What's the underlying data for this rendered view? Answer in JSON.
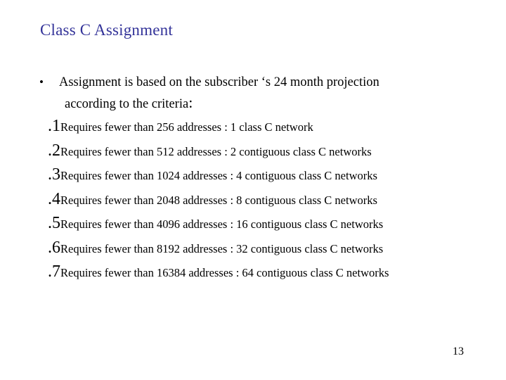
{
  "slide": {
    "title": "Class C Assignment",
    "bullet": {
      "marker": "•",
      "line1": "Assignment is based on the subscriber ‘s 24 month projection",
      "line2": "according to the criteria",
      "line2_colon": ":"
    },
    "items": [
      {
        "number": ".1",
        "text": "Requires fewer than 256 addresses : 1 class C network"
      },
      {
        "number": ".2",
        "text": "Requires fewer than 512 addresses : 2 contiguous class C networks"
      },
      {
        "number": ".3",
        "text": "Requires fewer than 1024 addresses : 4 contiguous class C networks"
      },
      {
        "number": ".4",
        "text": "Requires fewer than 2048 addresses : 8 contiguous class C networks"
      },
      {
        "number": ".5",
        "text": "Requires fewer than 4096 addresses : 16 contiguous class C networks"
      },
      {
        "number": ".6",
        "text": "Requires fewer than 8192 addresses : 32 contiguous class C networks"
      },
      {
        "number": ".7",
        "text": "Requires fewer than 16384 addresses : 64 contiguous class C networks"
      }
    ],
    "page_number": "13",
    "colors": {
      "title": "#333399",
      "body": "#000000",
      "background": "#ffffff"
    }
  }
}
